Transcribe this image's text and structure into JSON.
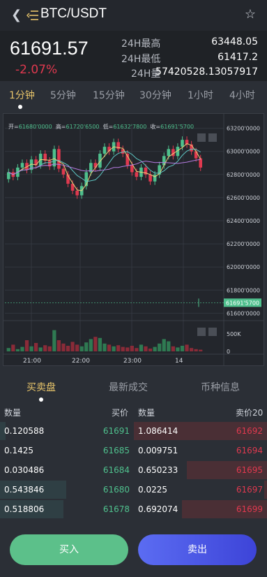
{
  "header": {
    "pair": "BTC/USDT"
  },
  "ticker": {
    "price": "61691.57",
    "change": "-2.07%",
    "high_label": "24H最高",
    "high_value": "63448.05",
    "low_label": "24H最低",
    "low_value": "61417.2",
    "vol_label": "24H量",
    "vol_value": "57420528.13057917"
  },
  "timeframes": [
    "1分钟",
    "5分钟",
    "15分钟",
    "30分钟",
    "1小时",
    "4小时"
  ],
  "ohlc": {
    "open_label": "开=",
    "open": "61680'0000",
    "high_label": "高=",
    "high": "61720'6500",
    "low_label": "低=",
    "low": "61632'7800",
    "close_label": "收=",
    "close": "61691'5700"
  },
  "chart_data": {
    "type": "candlestick",
    "y_ticks": [
      "63200'0000",
      "63000'0000",
      "62800'0000",
      "62600'0000",
      "62400'0000",
      "62200'0000",
      "62000'0000",
      "61800'0000",
      "61691'5700",
      "61600'0000"
    ],
    "x_ticks": [
      "21:00",
      "22:00",
      "23:00",
      "14"
    ],
    "volume_ticks": [
      "500K",
      "0"
    ],
    "current_price_label": "61691'5700",
    "ylim": [
      61560,
      63240
    ],
    "candles": [
      {
        "o": 62760,
        "c": 62820
      },
      {
        "o": 62820,
        "c": 62780
      },
      {
        "o": 62780,
        "c": 62860
      },
      {
        "o": 62860,
        "c": 62900
      },
      {
        "o": 62900,
        "c": 62840
      },
      {
        "o": 62840,
        "c": 62930
      },
      {
        "o": 62930,
        "c": 62880
      },
      {
        "o": 62880,
        "c": 62980
      },
      {
        "o": 62980,
        "c": 62920
      },
      {
        "o": 62920,
        "c": 62870
      },
      {
        "o": 62870,
        "c": 63020
      },
      {
        "o": 63020,
        "c": 62850
      },
      {
        "o": 62850,
        "c": 62800
      },
      {
        "o": 62800,
        "c": 62720
      },
      {
        "o": 62720,
        "c": 62660
      },
      {
        "o": 62660,
        "c": 62620
      },
      {
        "o": 62620,
        "c": 62700
      },
      {
        "o": 62700,
        "c": 62820
      },
      {
        "o": 62820,
        "c": 62900
      },
      {
        "o": 62900,
        "c": 62860
      },
      {
        "o": 62860,
        "c": 62980
      },
      {
        "o": 62980,
        "c": 63040
      },
      {
        "o": 63040,
        "c": 63000
      },
      {
        "o": 63000,
        "c": 63080
      },
      {
        "o": 63080,
        "c": 63020
      },
      {
        "o": 63020,
        "c": 62980
      },
      {
        "o": 62980,
        "c": 62880
      },
      {
        "o": 62880,
        "c": 62820
      },
      {
        "o": 62820,
        "c": 62780
      },
      {
        "o": 62780,
        "c": 62860
      },
      {
        "o": 62860,
        "c": 62800
      },
      {
        "o": 62800,
        "c": 62740
      },
      {
        "o": 62740,
        "c": 62800
      },
      {
        "o": 62800,
        "c": 62880
      },
      {
        "o": 62880,
        "c": 62960
      },
      {
        "o": 62960,
        "c": 63020
      },
      {
        "o": 63020,
        "c": 62960
      },
      {
        "o": 62960,
        "c": 63040
      },
      {
        "o": 63040,
        "c": 63100
      },
      {
        "o": 63100,
        "c": 63060
      },
      {
        "o": 63060,
        "c": 63000
      },
      {
        "o": 63000,
        "c": 62940
      },
      {
        "o": 62940,
        "c": 62860
      }
    ],
    "volumes": [
      60,
      120,
      40,
      80,
      200,
      90,
      150,
      70,
      110,
      90,
      380,
      200,
      140,
      100,
      170,
      120,
      90,
      160,
      220,
      260,
      240,
      140,
      120,
      90,
      110,
      80,
      70,
      100,
      60,
      120,
      90,
      50,
      80,
      140,
      220,
      180,
      90,
      70,
      100,
      120,
      60,
      40,
      30
    ]
  },
  "main_tabs": [
    "买卖盘",
    "最新成交",
    "币种信息"
  ],
  "orderbook": {
    "head": {
      "qty": "数量",
      "bid": "买价",
      "qty2": "数量",
      "ask": "卖价20"
    },
    "rows": [
      {
        "bid_qty": "0.120588",
        "bid_price": "61691",
        "bid_depth": 0.04,
        "ask_qty": "1.086414",
        "ask_price": "61692",
        "ask_depth": 1.0
      },
      {
        "bid_qty": "0.1425",
        "bid_price": "61685",
        "bid_depth": 0.0,
        "ask_qty": "0.009751",
        "ask_price": "61694",
        "ask_depth": 0.0
      },
      {
        "bid_qty": "0.030486",
        "bid_price": "61684",
        "bid_depth": 0.0,
        "ask_qty": "0.650233",
        "ask_price": "61695",
        "ask_depth": 0.6
      },
      {
        "bid_qty": "0.543846",
        "bid_price": "61680",
        "bid_depth": 0.5,
        "ask_qty": "0.0225",
        "ask_price": "61697",
        "ask_depth": 0.02
      },
      {
        "bid_qty": "0.518806",
        "bid_price": "61678",
        "bid_depth": 0.48,
        "ask_qty": "0.692074",
        "ask_price": "61699",
        "ask_depth": 0.64
      }
    ]
  },
  "actions": {
    "buy": "买入",
    "sell": "卖出"
  },
  "colors": {
    "up": "#4fc08d",
    "down": "#e0394f",
    "accent": "#e7c46a"
  }
}
